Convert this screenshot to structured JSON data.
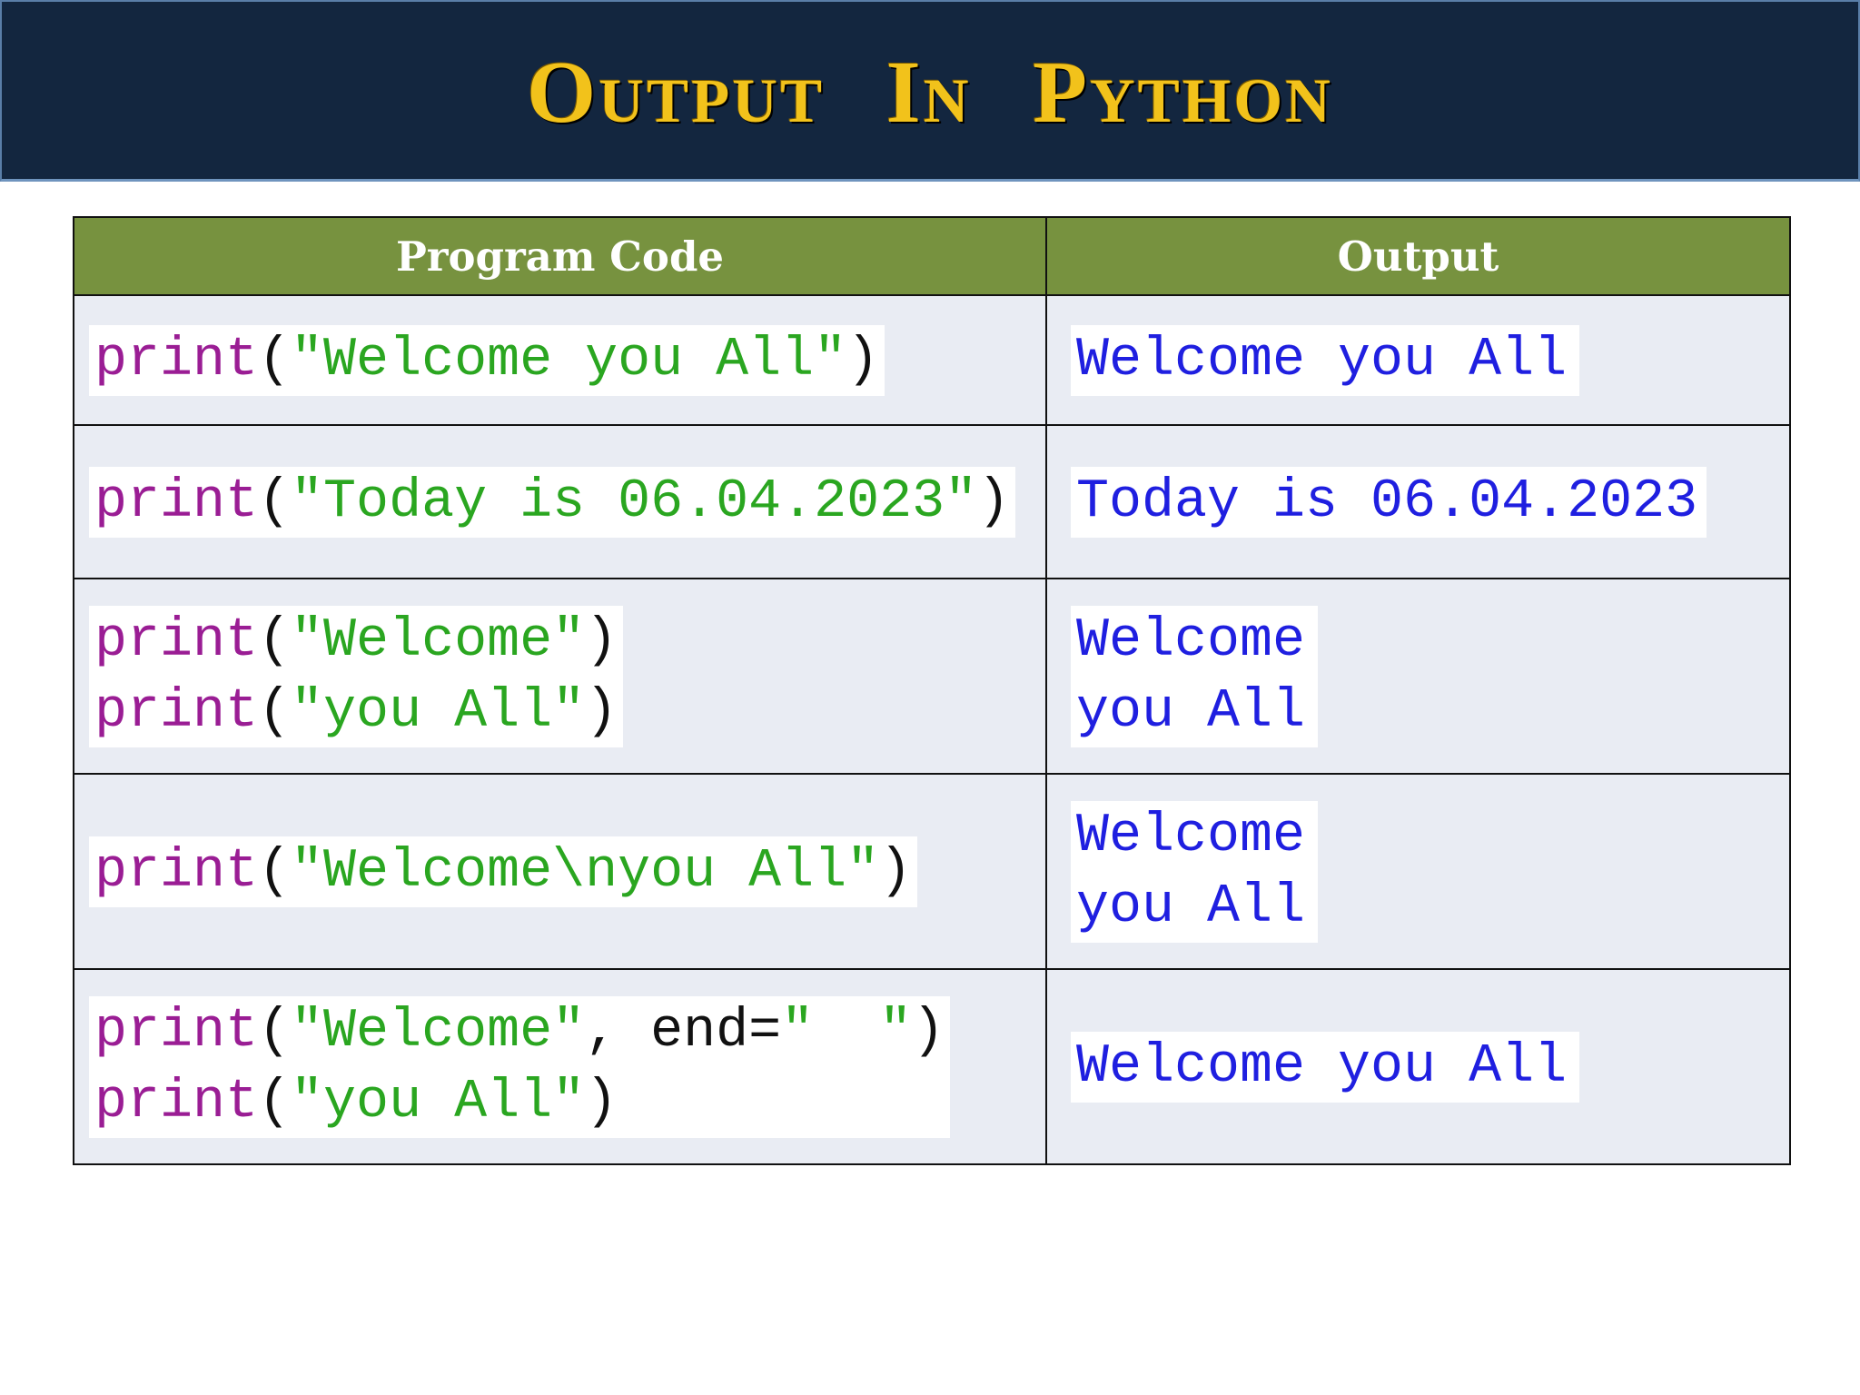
{
  "banner": {
    "title": "Output In Python"
  },
  "table": {
    "headers": [
      "Program Code",
      "Output"
    ],
    "rows": [
      {
        "code": [
          {
            "kw": "print",
            "open": "(",
            "str": "\"Welcome you All\"",
            "rest": ")"
          }
        ],
        "output": [
          "Welcome you All"
        ]
      },
      {
        "code": [
          {
            "kw": "print",
            "open": "(",
            "str": "\"Today is 06.04.2023\"",
            "rest": ")"
          }
        ],
        "output": [
          "Today is 06.04.2023"
        ]
      },
      {
        "code": [
          {
            "kw": "print",
            "open": "(",
            "str": "\"Welcome\"",
            "rest": ")"
          },
          {
            "kw": "print",
            "open": "(",
            "str": "\"you All\"",
            "rest": ")"
          }
        ],
        "output": [
          "Welcome",
          "you All"
        ]
      },
      {
        "code": [
          {
            "kw": "print",
            "open": "(",
            "str": "\"Welcome\\nyou All\"",
            "rest": ")"
          }
        ],
        "output": [
          "Welcome",
          "you All"
        ]
      },
      {
        "code": [
          {
            "kw": "print",
            "open": "(",
            "str": "\"Welcome\"",
            "mid": ", end=",
            "str2": "\"  \"",
            "rest": ")"
          },
          {
            "kw": "print",
            "open": "(",
            "str": "\"you All\"",
            "rest": ")"
          }
        ],
        "output": [
          "Welcome you All"
        ]
      }
    ]
  },
  "colors": {
    "banner_bg": "#13263f",
    "title_gold": "#f2c21b",
    "header_green": "#77923f",
    "keyword_purple": "#9a1d94",
    "string_green": "#2aa620",
    "output_blue": "#1f1fe0"
  }
}
